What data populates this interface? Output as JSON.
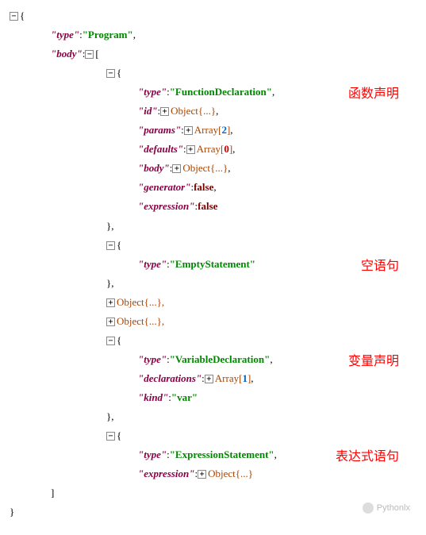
{
  "root": {
    "open": "{",
    "close": "}"
  },
  "program": {
    "typeKey": "\"type\"",
    "typeValue": "\"Program\"",
    "bodyKey": "\"body\"",
    "bodyClose": "]"
  },
  "funcDecl": {
    "open": "{",
    "typeKey": "\"type\"",
    "typeValue": "\"FunctionDeclaration\"",
    "idKey": "\"id\"",
    "idValue": "Object{...}",
    "paramsKey": "\"params\"",
    "paramsPrefix": "Array[",
    "paramsNum": "2",
    "paramsSuffix": "]",
    "defaultsKey": "\"defaults\"",
    "defaultsPrefix": "Array[",
    "defaultsNum": "0",
    "defaultsSuffix": "]",
    "bodyKey": "\"body\"",
    "bodyValue": "Object{...}",
    "generatorKey": "\"generator\"",
    "generatorValue": "false",
    "expressionKey": "\"expression\"",
    "expressionValue": "false",
    "close": "},",
    "annotation": "函数声明"
  },
  "emptyStmt": {
    "open": "{",
    "typeKey": "\"type\"",
    "typeValue": "\"EmptyStatement\"",
    "close": "},",
    "annotation": "空语句"
  },
  "collapsed1": {
    "text": "Object{...},"
  },
  "collapsed2": {
    "text": "Object{...},"
  },
  "varDecl": {
    "open": "{",
    "typeKey": "\"type\"",
    "typeValue": "\"VariableDeclaration\"",
    "declKey": "\"declarations\"",
    "declPrefix": "Array[",
    "declNum": "1",
    "declSuffix": "]",
    "kindKey": "\"kind\"",
    "kindValue": "\"var\"",
    "close": "},",
    "annotation": "变量声明"
  },
  "exprStmt": {
    "open": "{",
    "typeKey": "\"type\"",
    "typeValue": "\"ExpressionStatement\"",
    "exprKey": "\"expression\"",
    "exprValue": "Object{...}",
    "annotation": "表达式语句"
  },
  "watermark": "Pythonlx",
  "toggleMinus": "−",
  "togglePlus": "+",
  "colon": ":",
  "comma": ","
}
